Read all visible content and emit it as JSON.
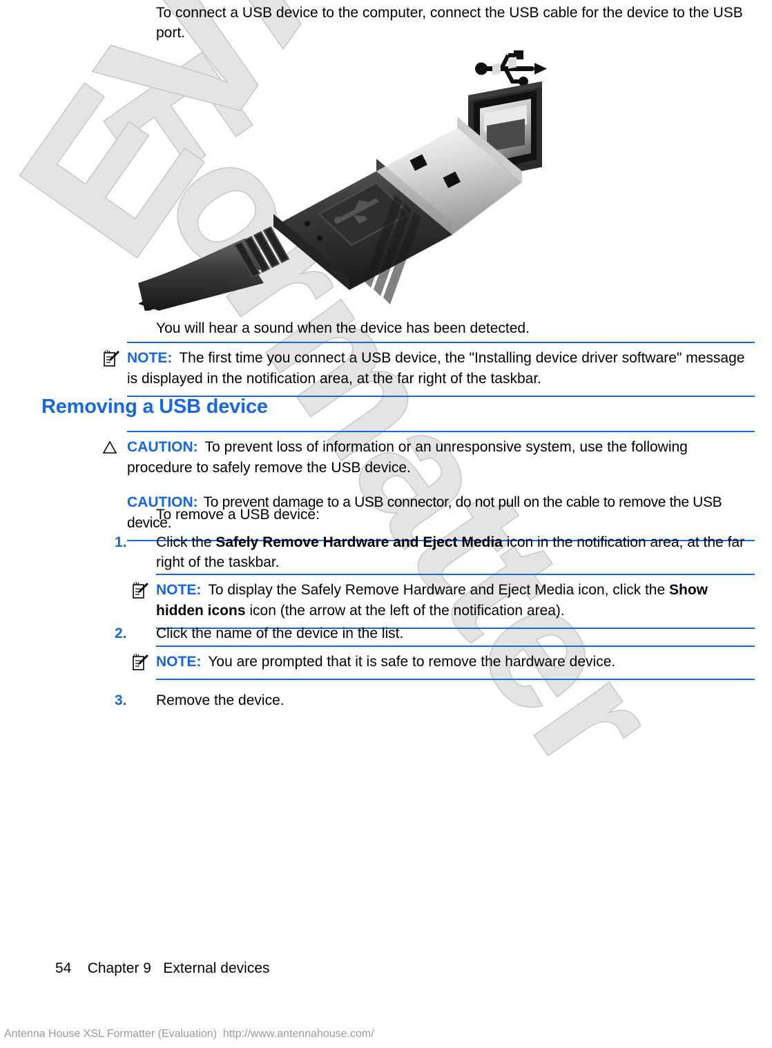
{
  "document": {
    "intro_paragraph": "To connect a USB device to the computer, connect the USB cable for the device to the USB port.",
    "figure_caption_alt": "usb-cable-and-port-illustration",
    "after_figure_paragraph": "You will hear a sound when the device has been detected.",
    "note_1": {
      "label": "NOTE:",
      "text": "The first time you connect a USB device, the \"Installing device driver software\" message is displayed in the notification area, at the far right of the taskbar."
    },
    "heading": "Removing a USB device",
    "caution_1": {
      "label": "CAUTION:",
      "text": "To prevent loss of information or an unresponsive system, use the following procedure to safely remove the USB device."
    },
    "caution_2": {
      "label": "CAUTION:",
      "text": "To prevent damage to a USB connector, do not pull on the cable to remove the USB device."
    },
    "lead_in": "To remove a USB device:",
    "steps": [
      {
        "number": "1.",
        "text_before": "Click the ",
        "bold": "Safely Remove Hardware and Eject Media",
        "text_after": " icon in the notification area, at the far right of the taskbar."
      },
      {
        "number": "2.",
        "text_before": "Click the name of the device in the list.",
        "bold": "",
        "text_after": ""
      },
      {
        "number": "3.",
        "text_before": "Remove the device.",
        "bold": "",
        "text_after": ""
      }
    ],
    "note_2": {
      "label": "NOTE:",
      "text_before": "To display the Safely Remove Hardware and Eject Media icon, click the ",
      "bold": "Show hidden icons",
      "text_after": " icon (the arrow at the left of the notification area)."
    },
    "note_3": {
      "label": "NOTE:",
      "text": "You are prompted that it is safe to remove the hardware device."
    }
  },
  "footer": {
    "page_number": "54",
    "chapter": "Chapter 9",
    "chapter_title": "External devices",
    "page_line": "54    Chapter 9   External devices",
    "evaluation_notice": "Antenna House XSL Formatter (Evaluation)  http://www.antennahouse.com/"
  },
  "watermark": {
    "word_1": "Formatter",
    "word_2": "EVALUATION"
  },
  "colors": {
    "accent_blue": "#1668e0",
    "rule_blue": "#1668e0",
    "watermark_fill": "#e4e4e4",
    "watermark_stroke": "#c6c6c6",
    "footer_gray": "#9a9a9a"
  },
  "icons": {
    "note": "note-pad-pencil-icon",
    "caution": "caution-triangle-icon",
    "usb_logo": "usb-logo-icon"
  }
}
